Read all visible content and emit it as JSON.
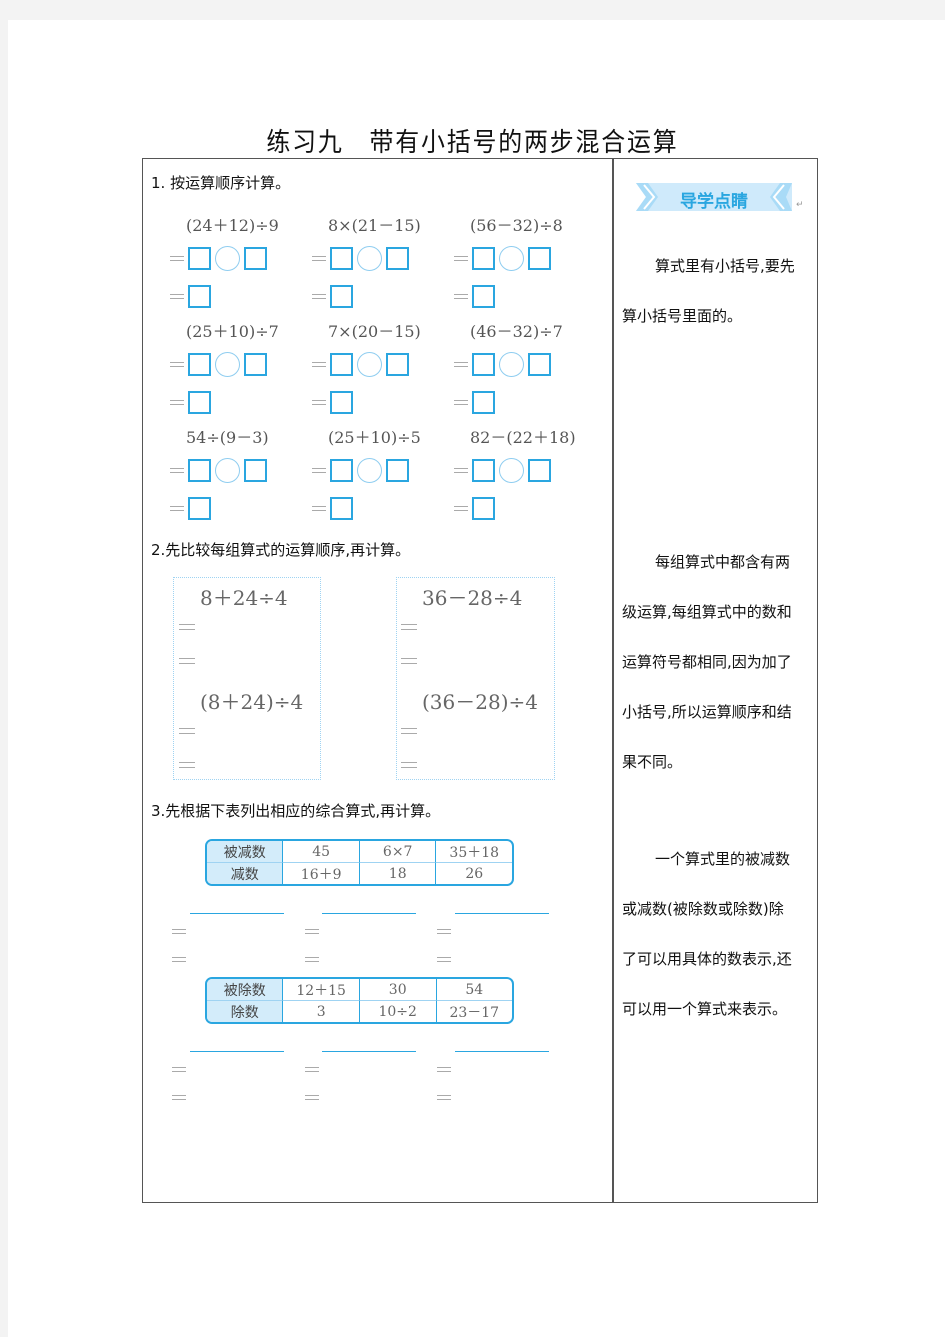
{
  "title": "练习九　带有小括号的两步混合运算",
  "section1": {
    "heading": "1.  按运算顺序计算。",
    "problems": [
      {
        "expr": "(24＋12)÷9"
      },
      {
        "expr": "8×(21－15)"
      },
      {
        "expr": "(56－32)÷8"
      },
      {
        "expr": "(25＋10)÷7"
      },
      {
        "expr": "7×(20－15)"
      },
      {
        "expr": "(46－32)÷7"
      },
      {
        "expr": "54÷(9－3)"
      },
      {
        "expr": "(25＋10)÷5"
      },
      {
        "expr": "82－(22＋18)"
      }
    ]
  },
  "section2": {
    "heading": "2.先比较每组算式的运算顺序,再计算。",
    "groups": [
      {
        "expr_a": "8＋24÷4",
        "expr_b": "(8＋24)÷4"
      },
      {
        "expr_a": "36－28÷4",
        "expr_b": "(36－28)÷4"
      }
    ]
  },
  "section3": {
    "heading": "3.先根据下表列出相应的综合算式,再计算。",
    "table1": {
      "row1_label": "被减数",
      "row1": [
        "45",
        "6×7",
        "35＋18"
      ],
      "row2_label": "减数",
      "row2": [
        "16＋9",
        "18",
        "26"
      ]
    },
    "table2": {
      "row1_label": "被除数",
      "row1": [
        "12＋15",
        "30",
        "54"
      ],
      "row2_label": "除数",
      "row2": [
        "3",
        "10÷2",
        "23－17"
      ]
    }
  },
  "sidebar": {
    "banner": "导学点睛",
    "tip1": [
      "算式里有小括号,要先",
      "算小括号里面的。"
    ],
    "tip2": [
      "每组算式中都含有两",
      "级运算,每组算式中的数和",
      "运算符号都相同,因为加了",
      "小括号,所以运算顺序和结",
      "果不同。"
    ],
    "tip3": [
      "一个算式里的被减数",
      "或减数(被除数或除数)除",
      "了可以用具体的数表示,还",
      "可以用一个算式来表示。"
    ]
  },
  "colors": {
    "accent": "#2aa6e0",
    "light_accent": "#d3ecfa"
  }
}
